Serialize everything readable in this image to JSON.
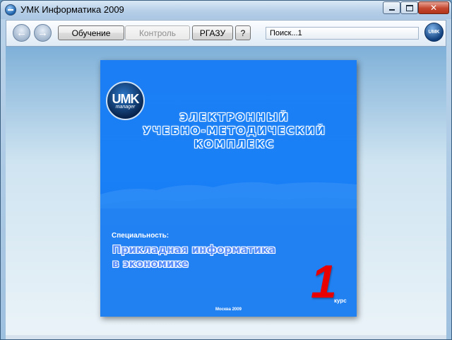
{
  "window": {
    "title": "УМК Информатика 2009",
    "close_glyph": "✕"
  },
  "toolbar": {
    "back_glyph": "←",
    "forward_glyph": "→",
    "buttons": [
      {
        "label": "Обучение",
        "enabled": true
      },
      {
        "label": "Контроль",
        "enabled": false
      },
      {
        "label": "РГАЗУ",
        "enabled": true
      },
      {
        "label": "?",
        "enabled": true
      }
    ],
    "search_value": "Поиск...1",
    "logo_text": "UMK"
  },
  "cover": {
    "logo_main": "UMK",
    "logo_sub": "manager",
    "heading_lines": [
      "ЭЛЕКТРОННЫЙ",
      "УЧЕБНО-МЕТОДИЧЕСКИЙ",
      "КОМПЛЕКС"
    ],
    "spec_label": "Специальность:",
    "spec_lines": [
      "Прикладная информатика",
      "в экономике"
    ],
    "course_number": "1",
    "course_word": "курс",
    "city_year": "Москва 2009"
  },
  "colors": {
    "cover_blue": "#1a80f6",
    "course_red": "#e80000",
    "close_red": "#c4472f"
  }
}
